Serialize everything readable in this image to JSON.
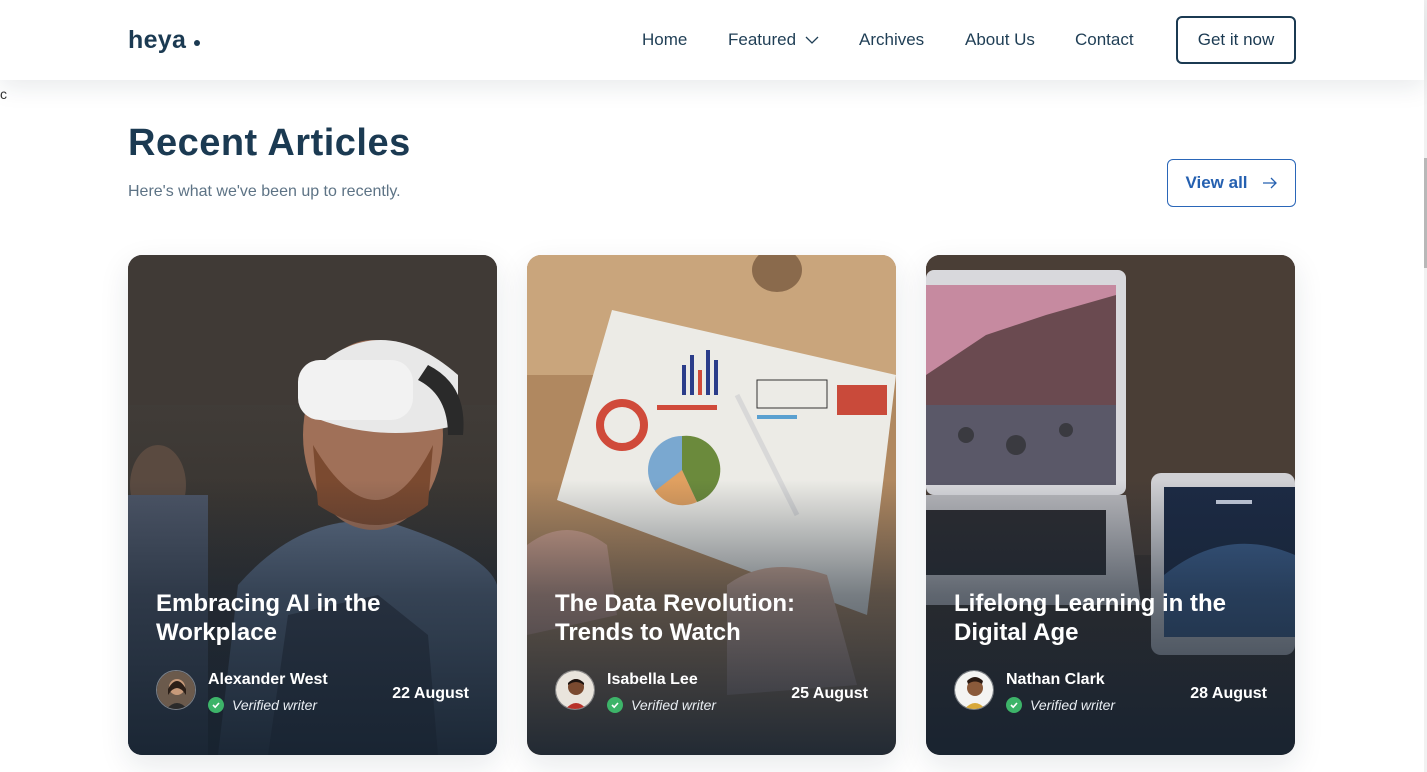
{
  "brand": {
    "logo": "heya"
  },
  "nav": {
    "items": [
      {
        "label": "Home"
      },
      {
        "label": "Featured"
      },
      {
        "label": "Archives"
      },
      {
        "label": "About Us"
      },
      {
        "label": "Contact"
      }
    ],
    "cta_label": "Get it now"
  },
  "stray_text": "c",
  "section": {
    "title": "Recent Articles",
    "subtitle": "Here's what we've been up to recently.",
    "view_all_label": "View all"
  },
  "articles": [
    {
      "title": "Embracing AI in the Workplace",
      "author": "Alexander West",
      "badge": "Verified writer",
      "date": "22 August",
      "image_icon": "vr-headset-photo"
    },
    {
      "title": "The Data Revolution: Trends to Watch",
      "author": "Isabella Lee",
      "badge": "Verified writer",
      "date": "25 August",
      "image_icon": "data-charts-photo"
    },
    {
      "title": "Lifelong Learning in the Digital Age",
      "author": "Nathan Clark",
      "badge": "Verified writer",
      "date": "28 August",
      "image_icon": "laptop-tablet-photo"
    }
  ],
  "colors": {
    "primary": "#1b3a52",
    "link_blue": "#2560b0",
    "verified_green": "#3db469",
    "muted_text": "#5d7385"
  }
}
